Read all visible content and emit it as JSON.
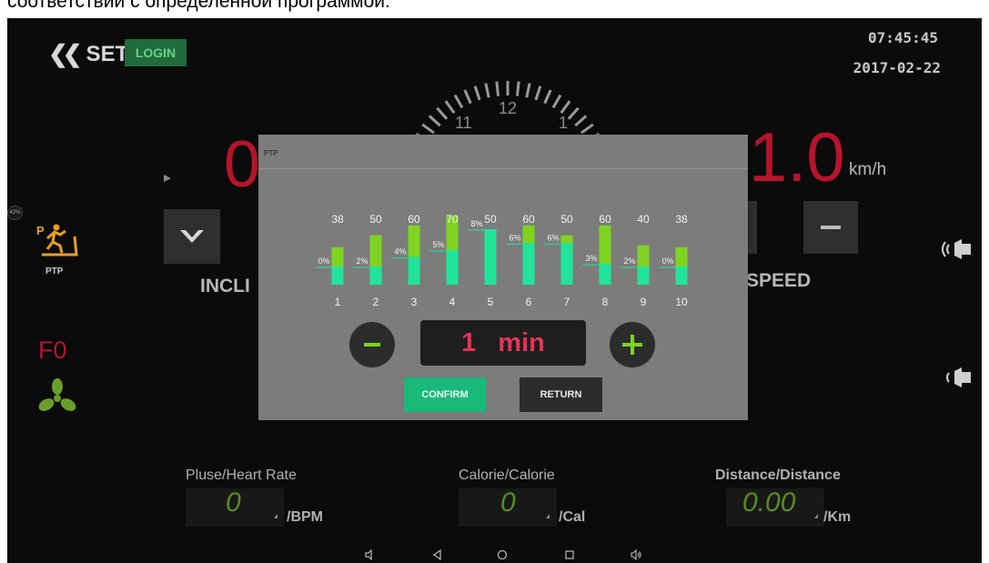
{
  "caption": "соответствии с определенной программой.",
  "header": {
    "set_label": "SET",
    "login_label": "LOGIN",
    "time": "07:45:45",
    "date": "2017-02-22"
  },
  "dial": {
    "numbers": [
      "11",
      "12",
      "1"
    ]
  },
  "left_panel": {
    "incline_value": "0",
    "incline_label": "INCLI",
    "program_label": "PTP",
    "fan_label": "F0",
    "badge": "42%"
  },
  "right_panel": {
    "speed_value": "1.0",
    "speed_unit": "km/h",
    "speed_label": "SPEED"
  },
  "stats": [
    {
      "label": "Pluse/Heart Rate",
      "value": "0",
      "unit": "/BPM"
    },
    {
      "label": "Calorie/Calorie",
      "value": "0",
      "unit": "/Cal"
    },
    {
      "label": "Distance/Distance",
      "value": "0.00",
      "unit": "/Km"
    }
  ],
  "dialog": {
    "title": "PTP",
    "duration_value": "1",
    "duration_unit": "min",
    "confirm_label": "CONFIRM",
    "return_label": "RETURN"
  },
  "chart_data": {
    "type": "bar",
    "categories": [
      "1",
      "2",
      "3",
      "4",
      "5",
      "6",
      "7",
      "8",
      "9",
      "10"
    ],
    "series": [
      {
        "values": [
          38,
          50,
          60,
          70,
          50,
          60,
          50,
          60,
          40,
          38
        ]
      },
      {
        "values": [
          0,
          2,
          4,
          5,
          8,
          6,
          6,
          3,
          2,
          0
        ]
      }
    ],
    "top_labels": [
      "38",
      "50",
      "60",
      "70",
      "50",
      "60",
      "50",
      "60",
      "40",
      "38"
    ],
    "incline_labels": [
      "0%",
      "2%",
      "4%",
      "5%",
      "8%",
      "6%",
      "6%",
      "3%",
      "2%",
      "0%"
    ],
    "colors": {
      "speed": "#7ed321",
      "incline": "#1fe49a"
    }
  },
  "colors": {
    "accent_red": "#b8142c",
    "confirm_green": "#19b97b",
    "login_green": "#1f6b3c",
    "value_green": "#5a8c1e"
  }
}
